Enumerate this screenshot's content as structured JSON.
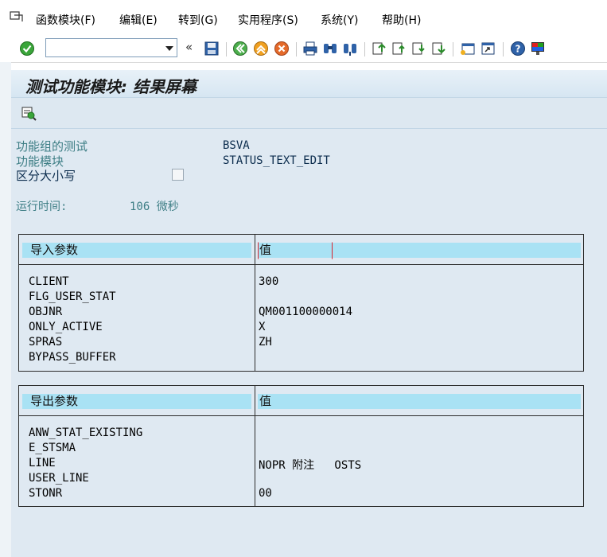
{
  "menu": {
    "items": [
      {
        "label": "函数模块(F)"
      },
      {
        "label": "编辑(E)"
      },
      {
        "label": "转到(G)"
      },
      {
        "label": "实用程序(S)"
      },
      {
        "label": "系统(Y)"
      },
      {
        "label": "帮助(H)"
      }
    ]
  },
  "toolbar": {
    "command_value": "",
    "nav_arrows": "«"
  },
  "title": "测试功能模块: 结果屏幕",
  "info": {
    "group_label": "功能组的测试",
    "group_value": "BSVA",
    "module_label": "功能模块",
    "module_value": "STATUS_TEXT_EDIT",
    "case_label": "区分大小写",
    "runtime_label": "运行时间:",
    "runtime_value": "106 微秒"
  },
  "import_table": {
    "header_name": "导入参数",
    "header_value": "值",
    "rows": [
      {
        "name": "CLIENT",
        "value": "300"
      },
      {
        "name": "FLG_USER_STAT",
        "value": ""
      },
      {
        "name": "OBJNR",
        "value": "QM001100000014"
      },
      {
        "name": "ONLY_ACTIVE",
        "value": "X"
      },
      {
        "name": "SPRAS",
        "value": "ZH"
      },
      {
        "name": "BYPASS_BUFFER",
        "value": ""
      }
    ]
  },
  "export_table": {
    "header_name": "导出参数",
    "header_value": "值",
    "rows": [
      {
        "name": "ANW_STAT_EXISTING",
        "value": ""
      },
      {
        "name": "E_STSMA",
        "value": ""
      },
      {
        "name": "LINE",
        "value": "NOPR 附注   OSTS"
      },
      {
        "name": "USER_LINE",
        "value": ""
      },
      {
        "name": "STONR",
        "value": "00"
      }
    ]
  }
}
